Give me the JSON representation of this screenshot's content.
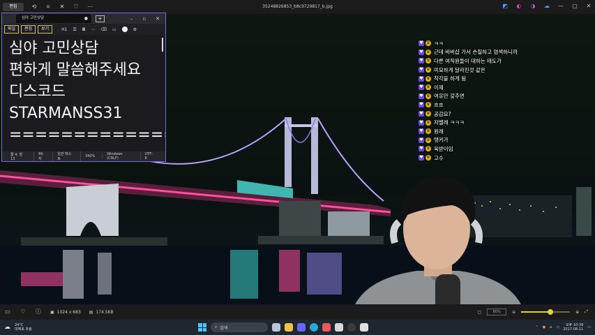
{
  "viewer": {
    "title": "35248826853_b8c9729817_b.jpg",
    "badge": "편집",
    "image_size": "1024 x 683",
    "file_size": "174.5KB",
    "zoom": "80%",
    "zoom_level": 0.6
  },
  "notepad": {
    "tab_title": "심야 고민상담",
    "menus": [
      "파일",
      "편집",
      "보기"
    ],
    "heading_label": "H1",
    "bold_label": "B",
    "lines": [
      "심야 고민상담",
      "편하게 말씀해주세요",
      "디스코드",
      "STARMANSS31",
      "================"
    ],
    "status": [
      "줄 4, 열 13",
      "86자",
      "일반 텍스트",
      "340%",
      "Windows (CRLF)",
      "UTF-8"
    ]
  },
  "chat": {
    "messages": [
      "ㅋㅋ",
      "근데 바버샵 가서 손질하고 염색하니까",
      "다른 여직원들이 대하는 태도가",
      "미묘하게 달라진것 같은",
      "착각을 하게 됨",
      "이제",
      "여유만 갖추면",
      "흐흐",
      "공감요?",
      "자벨레 ㅋㅋㅋ",
      "원래",
      "탱커가",
      "육받이임",
      "고수"
    ]
  },
  "taskbar": {
    "temperature": "24°C",
    "weather": "대체로 흐림",
    "search_placeholder": "검색",
    "time": "오후 10:39",
    "date": "2017-08-11"
  },
  "colors": {
    "accent": "#7b6fd6",
    "highlight": "#c8c060",
    "slider": "#e2d23a"
  }
}
